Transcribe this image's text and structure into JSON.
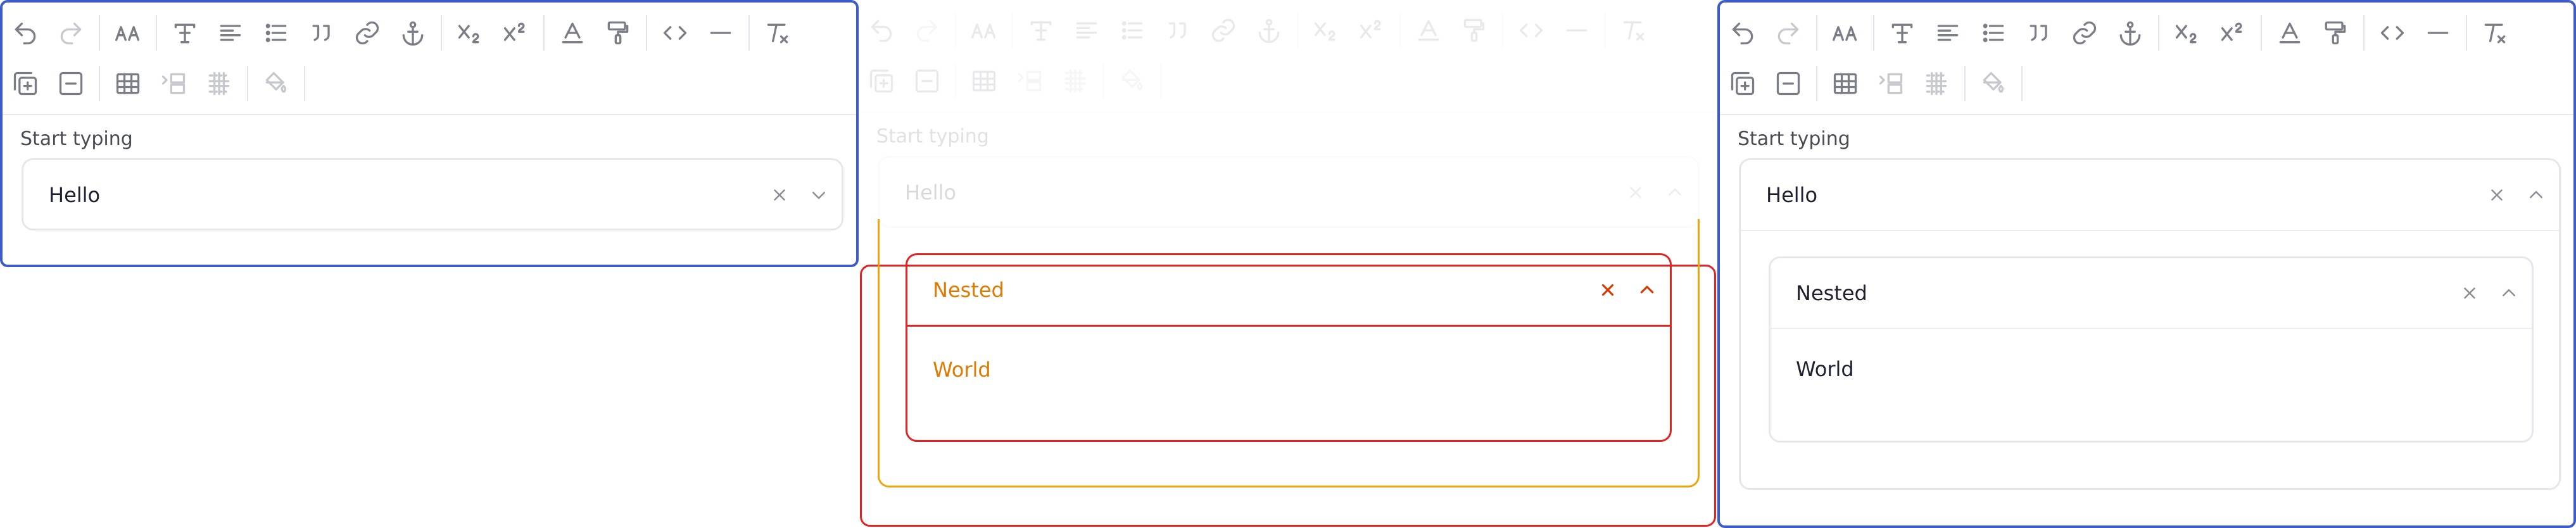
{
  "label": "Start typing",
  "outer_value": "Hello",
  "nested_value": "Nested",
  "nested_option": "World",
  "toolbar_row1": [
    "undo-icon",
    "redo-icon",
    "|",
    "font-size-icon",
    "|",
    "text-style-icon",
    "align-icon",
    "list-icon",
    "quote-icon",
    "link-icon",
    "anchor-icon",
    "|",
    "subscript-icon",
    "superscript-icon",
    "|",
    "text-color-icon",
    "format-painter-icon",
    "|",
    "code-icon",
    "horizontal-rule-icon",
    "|",
    "clear-format-icon"
  ],
  "toolbar_row2": [
    "insert-table-icon",
    "delete-table-icon",
    "|",
    "table-icon",
    "indent-row-icon",
    "column-grid-icon",
    "|",
    "fill-color-icon",
    "|"
  ],
  "colors": {
    "panel_border": "#3f5cc6",
    "highlight_red": "#e02323",
    "highlight_orange": "#f0a30c",
    "highlight_text": "#e07a00"
  }
}
